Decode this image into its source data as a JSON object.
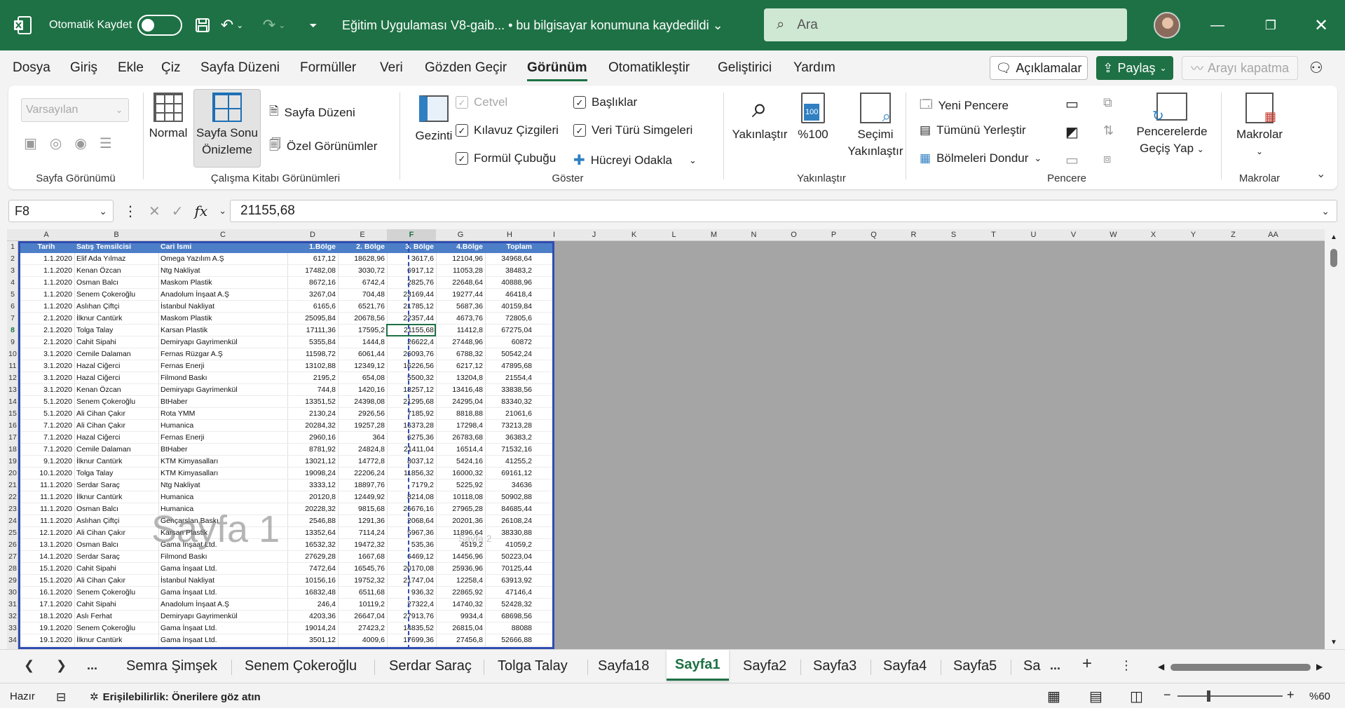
{
  "titlebar": {
    "autosave_label": "Otomatik Kaydet",
    "doc_title": "Eğitim Uygulaması V8-gaib... • bu bilgisayar konumuna kaydedildi ⌄",
    "search_placeholder": "Ara"
  },
  "menu": {
    "tabs": [
      "Dosya",
      "Giriş",
      "Ekle",
      "Çiz",
      "Sayfa Düzeni",
      "Formüller",
      "Veri",
      "Gözden Geçir",
      "Görünüm",
      "Otomatikleştir",
      "Geliştirici",
      "Yardım"
    ],
    "active": "Görünüm",
    "comments_label": "Açıklamalar",
    "share_label": "Paylaş",
    "call_label": "Arayı kapatma"
  },
  "ribbon": {
    "sheet_view": {
      "combo_value": "Varsayılan",
      "group_label": "Sayfa Görünümü"
    },
    "workbook_views": {
      "normal": "Normal",
      "page_break_1": "Sayfa Sonu",
      "page_break_2": "Önizleme",
      "page_layout": "Sayfa Düzeni",
      "custom_views": "Özel Görünümler",
      "group_label": "Çalışma Kitabı Görünümleri"
    },
    "show": {
      "navigation": "Gezinti",
      "ruler": "Cetvel",
      "gridlines": "Kılavuz Çizgileri",
      "formula_bar": "Formül Çubuğu",
      "headings": "Başlıklar",
      "data_types": "Veri Türü Simgeleri",
      "focus_cell": "Hücreyi Odakla",
      "group_label": "Göster"
    },
    "zoom": {
      "zoom": "Yakınlaştır",
      "hundred": "%100",
      "hundred_badge": "100",
      "sel_1": "Seçimi",
      "sel_2": "Yakınlaştır",
      "group_label": "Yakınlaştır"
    },
    "window": {
      "new_window": "Yeni Pencere",
      "arrange_all": "Tümünü Yerleştir",
      "freeze_panes": "Bölmeleri Dondur",
      "switch_1": "Pencerelerde",
      "switch_2": "Geçiş Yap",
      "group_label": "Pencere"
    },
    "macros": {
      "label": "Makrolar",
      "group_label": "Makrolar"
    }
  },
  "formula_bar": {
    "name_box": "F8",
    "value": "21155,68"
  },
  "grid": {
    "columns": [
      "A",
      "B",
      "C",
      "D",
      "E",
      "F",
      "G",
      "H",
      "I",
      "J",
      "K",
      "L",
      "M",
      "N",
      "O",
      "P",
      "Q",
      "R",
      "S",
      "T",
      "U",
      "V",
      "W",
      "X",
      "Y",
      "Z",
      "AA"
    ],
    "selected_column": "F",
    "headers": [
      "Tarih",
      "Satış Temsilcisi",
      "Cari İsmi",
      "1.Bölge",
      "2. Bölge",
      "3. Bölge",
      "4.Bölge",
      "Toplam"
    ],
    "rows": [
      [
        "1.1.2020",
        "Elif Ada Yılmaz",
        "Omega Yazılım A.Ş",
        "617,12",
        "18628,96",
        "3617,6",
        "12104,96",
        "34968,64"
      ],
      [
        "1.1.2020",
        "Kenan Özcan",
        "Ntg Nakliyat",
        "17482,08",
        "3030,72",
        "6917,12",
        "11053,28",
        "38483,2"
      ],
      [
        "1.1.2020",
        "Osman Balcı",
        "Maskom Plastik",
        "8672,16",
        "6742,4",
        "2825,76",
        "22648,64",
        "40888,96"
      ],
      [
        "1.1.2020",
        "Senem Çokeroğlu",
        "Anadolum İnşaat A.Ş",
        "3267,04",
        "704,48",
        "23169,44",
        "19277,44",
        "46418,4"
      ],
      [
        "1.1.2020",
        "Aslıhan Çiftçi",
        "İstanbul Nakliyat",
        "6165,6",
        "6521,76",
        "21785,12",
        "5687,36",
        "40159,84"
      ],
      [
        "2.1.2020",
        "İlknur Cantürk",
        "Maskom Plastik",
        "25095,84",
        "20678,56",
        "22357,44",
        "4673,76",
        "72805,6"
      ],
      [
        "2.1.2020",
        "Tolga Talay",
        "Karsan Plastik",
        "17111,36",
        "17595,2",
        "21155,68",
        "11412,8",
        "67275,04"
      ],
      [
        "2.1.2020",
        "Cahit Sipahi",
        "Demiryapı Gayrimenkül",
        "5355,84",
        "1444,8",
        "26622,4",
        "27448,96",
        "60872"
      ],
      [
        "3.1.2020",
        "Cemile Dalaman",
        "Fernas Rüzgar A.Ş",
        "11598,72",
        "6061,44",
        "26093,76",
        "6788,32",
        "50542,24"
      ],
      [
        "3.1.2020",
        "Hazal Ciğerci",
        "Fernas Enerji",
        "13102,88",
        "12349,12",
        "16226,56",
        "6217,12",
        "47895,68"
      ],
      [
        "3.1.2020",
        "Hazal Ciğerci",
        "Filmond Baskı",
        "2195,2",
        "654,08",
        "5500,32",
        "13204,8",
        "21554,4"
      ],
      [
        "3.1.2020",
        "Kenan Özcan",
        "Demiryapı Gayrimenkül",
        "744,8",
        "1420,16",
        "18257,12",
        "13416,48",
        "33838,56"
      ],
      [
        "5.1.2020",
        "Senem Çokeroğlu",
        "BtHaber",
        "13351,52",
        "24398,08",
        "21295,68",
        "24295,04",
        "83340,32"
      ],
      [
        "5.1.2020",
        "Ali Cihan Çakır",
        "Rota YMM",
        "2130,24",
        "2926,56",
        "7185,92",
        "8818,88",
        "21061,6"
      ],
      [
        "7.1.2020",
        "Ali Cihan Çakır",
        "Humanica",
        "20284,32",
        "19257,28",
        "16373,28",
        "17298,4",
        "73213,28"
      ],
      [
        "7.1.2020",
        "Hazal Ciğerci",
        "Fernas Enerji",
        "2960,16",
        "364",
        "6275,36",
        "26783,68",
        "36383,2"
      ],
      [
        "7.1.2020",
        "Cemile Dalaman",
        "BtHaber",
        "8781,92",
        "24824,8",
        "21411,04",
        "16514,4",
        "71532,16"
      ],
      [
        "9.1.2020",
        "İlknur Cantürk",
        "KTM Kimyasalları",
        "13021,12",
        "14772,8",
        "8037,12",
        "5424,16",
        "41255,2"
      ],
      [
        "10.1.2020",
        "Tolga Talay",
        "KTM Kimyasalları",
        "19098,24",
        "22206,24",
        "11856,32",
        "16000,32",
        "69161,12"
      ],
      [
        "11.1.2020",
        "Serdar Saraç",
        "Ntg Nakliyat",
        "3333,12",
        "18897,76",
        "7179,2",
        "5225,92",
        "34636"
      ],
      [
        "11.1.2020",
        "İlknur Cantürk",
        "Humanica",
        "20120,8",
        "12449,92",
        "8214,08",
        "10118,08",
        "50902,88"
      ],
      [
        "11.1.2020",
        "Osman Balcı",
        "Humanica",
        "20228,32",
        "9815,68",
        "26676,16",
        "27965,28",
        "84685,44"
      ],
      [
        "11.1.2020",
        "Aslıhan Çiftçi",
        "Gençarslan Baskı",
        "2546,88",
        "1291,36",
        "2068,64",
        "20201,36",
        "26108,24"
      ],
      [
        "12.1.2020",
        "Ali Cihan Çakır",
        "Karsan Plastik",
        "13352,64",
        "7114,24",
        "5967,36",
        "11896,64",
        "38330,88"
      ],
      [
        "13.1.2020",
        "Osman Balcı",
        "Gama İnşaat Ltd.",
        "16532,32",
        "19472,32",
        "535,36",
        "4519,2",
        "41059,2"
      ],
      [
        "14.1.2020",
        "Serdar Saraç",
        "Filmond Baskı",
        "27629,28",
        "1667,68",
        "6469,12",
        "14456,96",
        "50223,04"
      ],
      [
        "15.1.2020",
        "Cahit Sipahi",
        "Gama İnşaat Ltd.",
        "7472,64",
        "16545,76",
        "20170,08",
        "25936,96",
        "70125,44"
      ],
      [
        "15.1.2020",
        "Ali Cihan Çakır",
        "İstanbul Nakliyat",
        "10156,16",
        "19752,32",
        "21747,04",
        "12258,4",
        "63913,92"
      ],
      [
        "16.1.2020",
        "Senem Çokeroğlu",
        "Gama İnşaat Ltd.",
        "16832,48",
        "6511,68",
        "936,32",
        "22865,92",
        "47146,4"
      ],
      [
        "17.1.2020",
        "Cahit Sipahi",
        "Anadolum İnşaat A.Ş",
        "246,4",
        "10119,2",
        "27322,4",
        "14740,32",
        "52428,32"
      ],
      [
        "18.1.2020",
        "Aslı Ferhat",
        "Demiryapı Gayrimenkül",
        "4203,36",
        "26647,04",
        "27913,76",
        "9934,4",
        "68698,56"
      ],
      [
        "19.1.2020",
        "Senem Çokeroğlu",
        "Gama İnşaat Ltd.",
        "19014,24",
        "27423,2",
        "14835,52",
        "26815,04",
        "88088"
      ],
      [
        "19.1.2020",
        "İlknur Cantürk",
        "Gama İnşaat Ltd.",
        "3501,12",
        "4009,6",
        "17699,36",
        "27456,8",
        "52666,88"
      ]
    ],
    "watermark_main": "Sayfa 1",
    "watermark_small": "Sayfa 2"
  },
  "sheet_tabs": {
    "tabs": [
      "Semra Şimşek",
      "Senem Çokeroğlu",
      "Serdar Saraç",
      "Tolga Talay",
      "Sayfa18",
      "Sayfa1",
      "Sayfa2",
      "Sayfa3",
      "Sayfa4",
      "Sayfa5",
      "Sa"
    ],
    "active": "Sayfa1",
    "more": "...",
    "add": "+"
  },
  "statusbar": {
    "ready": "Hazır",
    "accessibility": "Erişilebilirlik: Önerilere göz atın",
    "zoom": "%60"
  }
}
